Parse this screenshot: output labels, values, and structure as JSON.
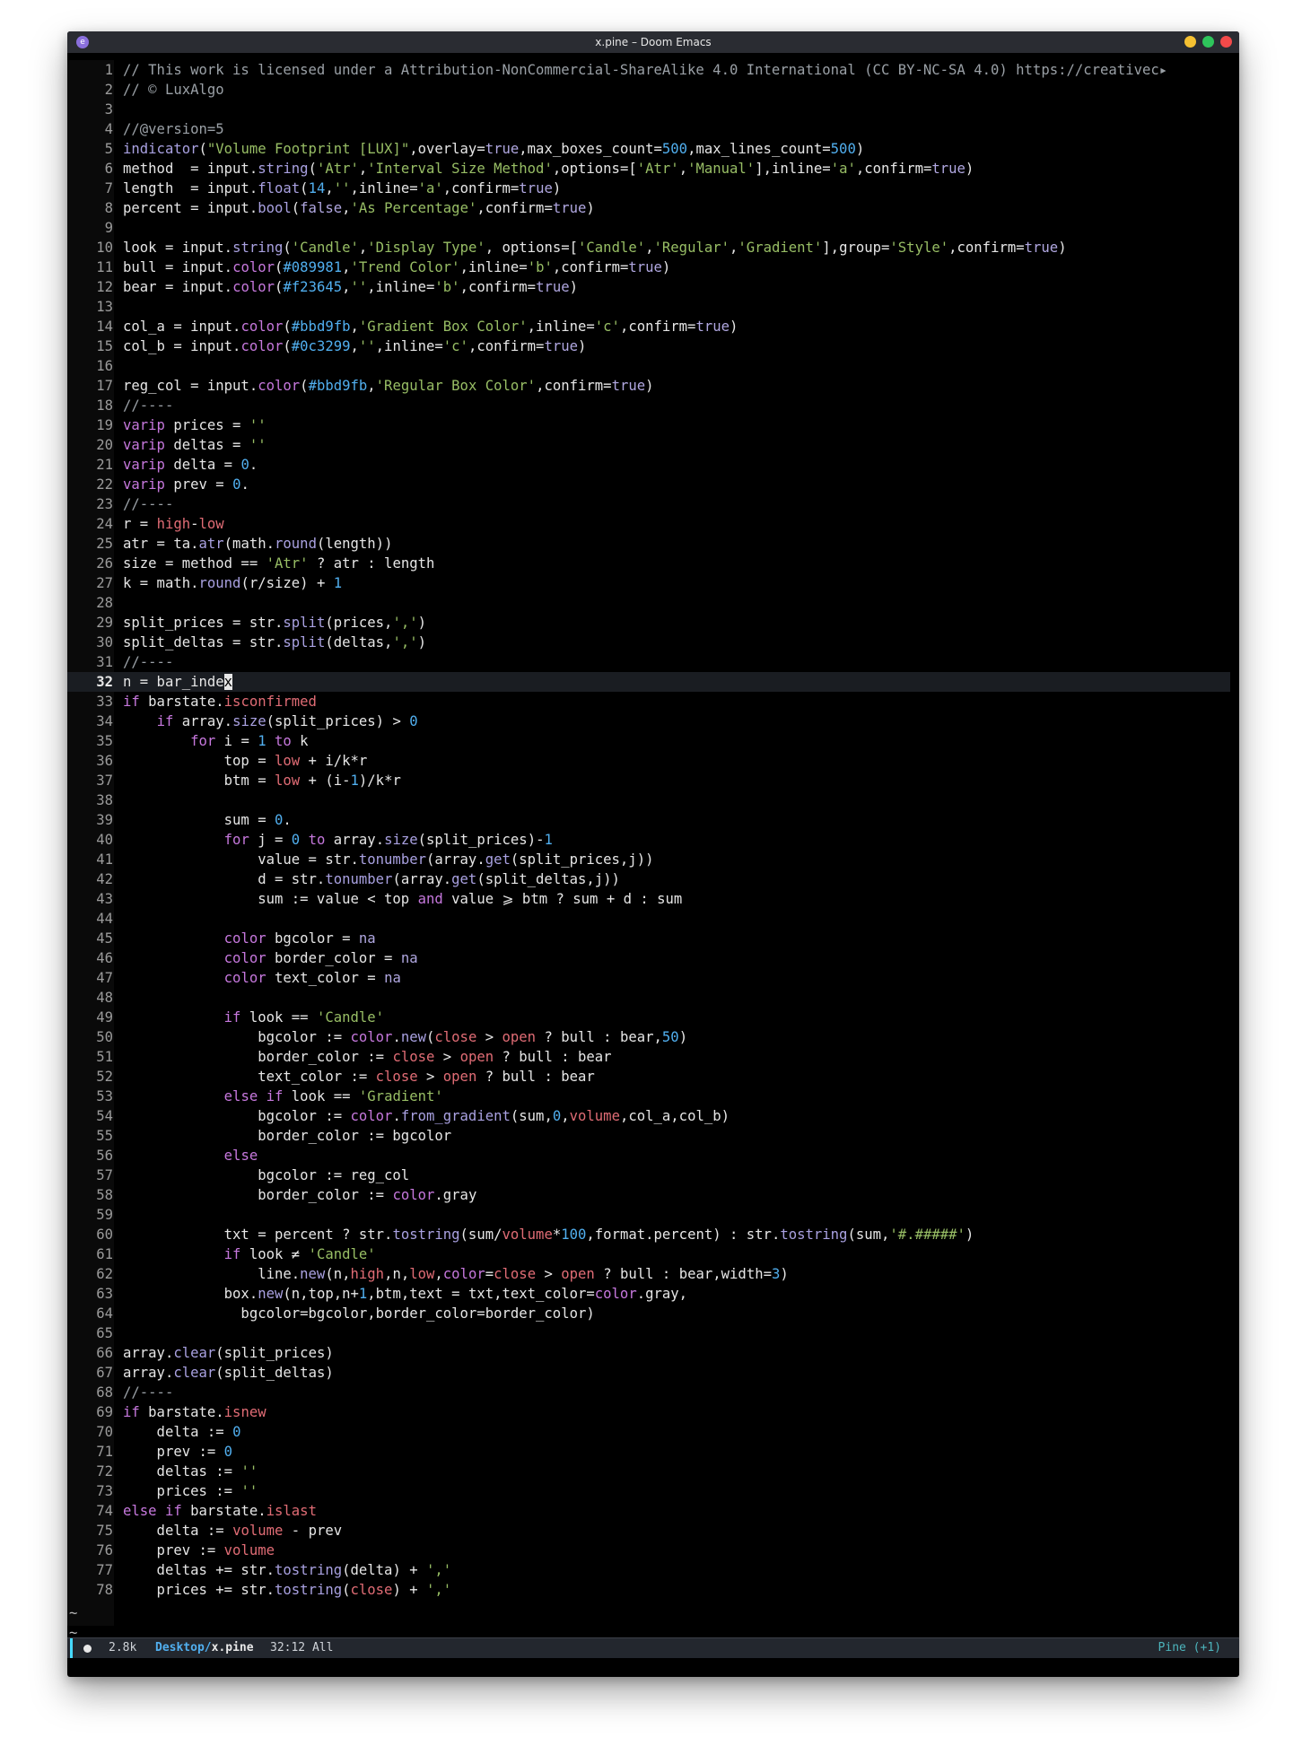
{
  "window": {
    "title": "x.pine – Doom Emacs",
    "app_icon": "emacs-icon",
    "buttons": [
      {
        "name": "minimize",
        "color": "#f5c132"
      },
      {
        "name": "maximize",
        "color": "#2ec55b"
      },
      {
        "name": "close",
        "color": "#f24a4a"
      }
    ]
  },
  "editor": {
    "current_line": 32,
    "lines": [
      "// This work is licensed under a Attribution-NonCommercial-ShareAlike 4.0 International (CC BY-NC-SA 4.0) https://creativec▸",
      "// © LuxAlgo",
      "",
      "//@version=5",
      "indicator(\"Volume Footprint [LUX]\",overlay=true,max_boxes_count=500,max_lines_count=500)",
      "method  = input.string('Atr','Interval Size Method',options=['Atr','Manual'],inline='a',confirm=true)",
      "length  = input.float(14,'',inline='a',confirm=true)",
      "percent = input.bool(false,'As Percentage',confirm=true)",
      "",
      "look = input.string('Candle','Display Type', options=['Candle','Regular','Gradient'],group='Style',confirm=true)",
      "bull = input.color(#089981,'Trend Color',inline='b',confirm=true)",
      "bear = input.color(#f23645,'',inline='b',confirm=true)",
      "",
      "col_a = input.color(#bbd9fb,'Gradient Box Color',inline='c',confirm=true)",
      "col_b = input.color(#0c3299,'',inline='c',confirm=true)",
      "",
      "reg_col = input.color(#bbd9fb,'Regular Box Color',confirm=true)",
      "//----",
      "varip prices = ''",
      "varip deltas = ''",
      "varip delta = 0.",
      "varip prev = 0.",
      "//----",
      "r = high-low",
      "atr = ta.atr(math.round(length))",
      "size = method == 'Atr' ? atr : length",
      "k = math.round(r/size) + 1",
      "",
      "split_prices = str.split(prices,',')",
      "split_deltas = str.split(deltas,',')",
      "//----",
      "n = bar_index",
      "if barstate.isconfirmed",
      "    if array.size(split_prices) > 0",
      "        for i = 1 to k",
      "            top = low + i/k*r",
      "            btm = low + (i-1)/k*r",
      "",
      "            sum = 0.",
      "            for j = 0 to array.size(split_prices)-1",
      "                value = str.tonumber(array.get(split_prices,j))",
      "                d = str.tonumber(array.get(split_deltas,j))",
      "                sum := value < top and value ⩾ btm ? sum + d : sum",
      "",
      "            color bgcolor = na",
      "            color border_color = na",
      "            color text_color = na",
      "",
      "            if look == 'Candle'",
      "                bgcolor := color.new(close > open ? bull : bear,50)",
      "                border_color := close > open ? bull : bear",
      "                text_color := close > open ? bull : bear",
      "            else if look == 'Gradient'",
      "                bgcolor := color.from_gradient(sum,0,volume,col_a,col_b)",
      "                border_color := bgcolor",
      "            else",
      "                bgcolor := reg_col",
      "                border_color := color.gray",
      "",
      "            txt = percent ? str.tostring(sum/volume*100,format.percent) : str.tostring(sum,'#.#####')",
      "            if look ≠ 'Candle'",
      "                line.new(n,high,n,low,color=close > open ? bull : bear,width=3)",
      "            box.new(n,top,n+1,btm,text = txt,text_color=color.gray,",
      "              bgcolor=bgcolor,border_color=border_color)",
      "",
      "array.clear(split_prices)",
      "array.clear(split_deltas)",
      "//----",
      "if barstate.isnew",
      "    delta := 0",
      "    prev := 0",
      "    deltas := ''",
      "    prices := ''",
      "else if barstate.islast",
      "    delta := volume - prev",
      "    prev := volume",
      "    deltas += str.tostring(delta) + ','",
      "    prices += str.tostring(close) + ','"
    ],
    "tildes": [
      "~",
      "~"
    ]
  },
  "modeline": {
    "size": "2.8k",
    "path_dir": "Desktop/",
    "file": "x.pine",
    "position": "32:12 All",
    "major_mode": "Pine (+1)"
  }
}
